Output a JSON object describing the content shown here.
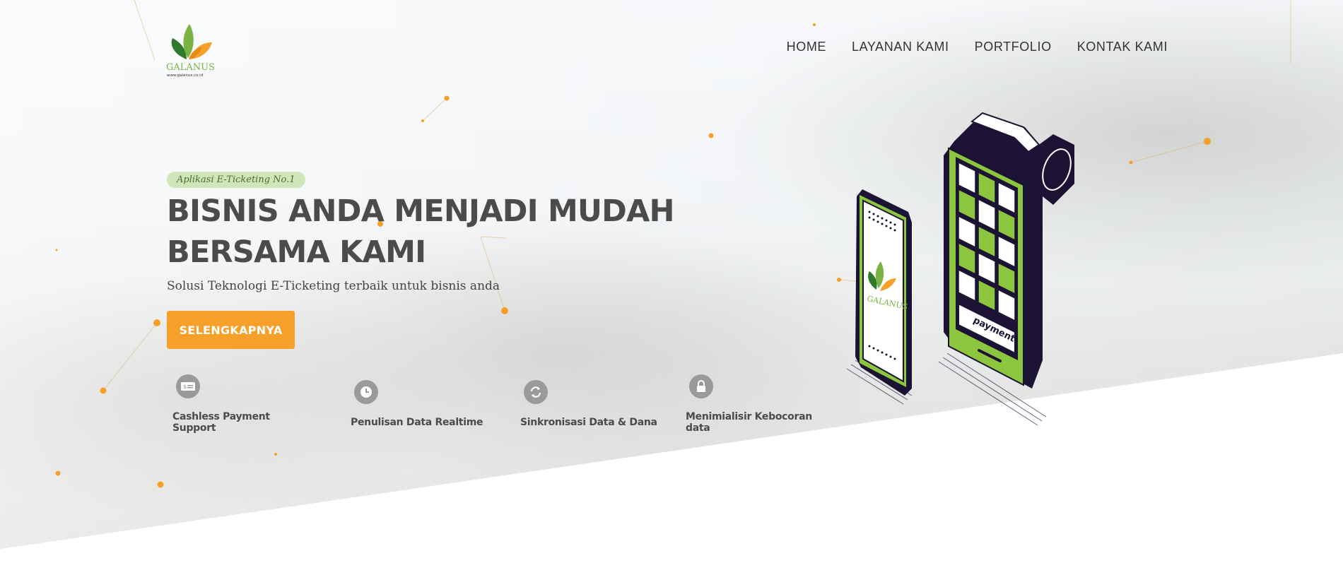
{
  "brand": {
    "logo_text": "GALANUS",
    "logo_url_text": "www.galanus.co.id"
  },
  "nav": {
    "items": [
      "HOME",
      "LAYANAN KAMI",
      "PORTFOLIO",
      "KONTAK KAMI"
    ]
  },
  "hero": {
    "badge": "Aplikasi E-Ticketing No.1",
    "title": "BISNIS ANDA MENJADI MUDAH BERSAMA KAMI",
    "subtitle": "Solusi Teknologi E-Ticketing terbaik untuk bisnis anda",
    "cta_label": "SELENGKAPNYA"
  },
  "features": [
    {
      "icon": "cash-icon",
      "label_lines": [
        "Cashless Payment",
        "Support"
      ]
    },
    {
      "icon": "clock-icon",
      "label_lines": [
        "Penulisan Data Realtime"
      ]
    },
    {
      "icon": "sync-icon",
      "label_lines": [
        "Sinkronisasi Data & Dana"
      ]
    },
    {
      "icon": "lock-icon",
      "label_lines": [
        "Menimialisir Kebocoran",
        "data"
      ]
    }
  ],
  "illustration": {
    "phone_logo_text": "GALANUS",
    "terminal_label": "payment"
  },
  "colors": {
    "accent_orange": "#f6a02a",
    "accent_green": "#8cc63f",
    "dark_navy": "#1c1233",
    "heading_gray": "#4b4b4b",
    "badge_bg": "#cfe6b8"
  }
}
